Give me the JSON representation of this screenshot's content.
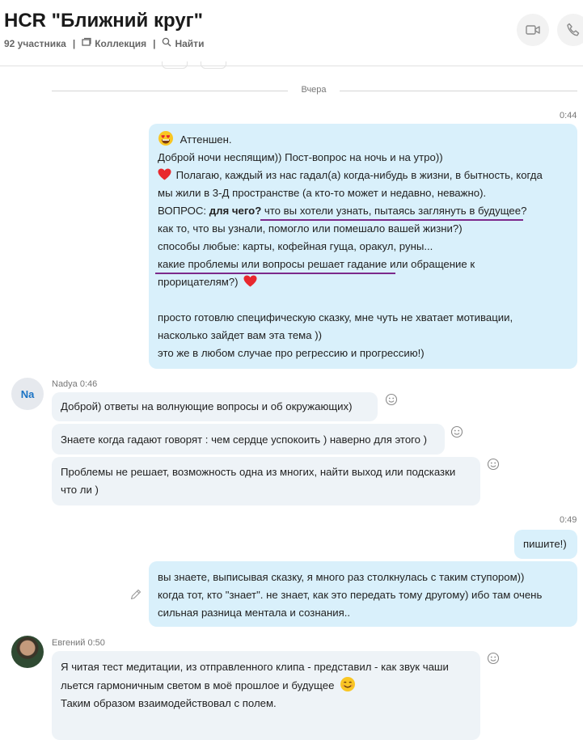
{
  "header": {
    "title": "HCR \"Ближний круг\"",
    "participants": "92 участника",
    "collection": "Коллекция",
    "find": "Найти"
  },
  "divider": {
    "label": "Вчера"
  },
  "messages": {
    "m1": {
      "time": "0:44",
      "l1": "Аттеншен.",
      "l2": "Доброй ночи неспящим)) Пост-вопрос на ночь и на утро))",
      "l3": "Полагаю, каждый из нас гадал(а) когда-нибудь в жизни, в бытность, когда",
      "l4": "мы жили в 3-Д пространстве (а кто-то может и недавно, неважно).",
      "l5a": "ВОПРОС: ",
      "l5b": "для чего?",
      "l5c": " что вы хотели узнать, пытаясь заглянуть в будущее?",
      "l6": "как то, что вы узнали, помогло или помешало вашей жизни?)",
      "l7": "способы любые: карты, кофейная гуща, оракул, руны...",
      "l8": "какие проблемы или вопросы решает гадание или обращение к",
      "l9": "прорицателям?)",
      "l10": "просто готовлю специфическую сказку, мне чуть не хватает мотивации,",
      "l11": "насколько зайдет вам эта тема ))",
      "l12": "это же в любом случае про регрессию и прогрессию!)"
    },
    "nadya": {
      "avatar": "Na",
      "sender": "Nadya 0:46",
      "b1": "Доброй) ответы на волнующие вопросы и об окружающих)",
      "b2": "Знаете когда гадают говорят : чем сердце успокоить ) наверно для этого )",
      "b3l1": "Проблемы не решает, возможность одна из многих, найти выход или подсказки",
      "b3l2": "что ли )"
    },
    "m2": {
      "time": "0:49",
      "b1": "пишите!)",
      "b2l1": "вы знаете, выписывая сказку, я много раз столкнулась с таким ступором))",
      "b2l2": "когда тот, кто \"знает\". не знает, как это передать тому другому) ибо там очень",
      "b2l3": "сильная разница ментала и сознания.."
    },
    "evgeny": {
      "sender": "Евгений 0:50",
      "l1": "Я читая тест медитации, из отправленного клипа - представил - как звук чаши",
      "l2": "льется гармоничным светом в моё прошлое и будущее",
      "l3": "Таким образом взаимодействовал с полем."
    }
  },
  "colors": {
    "outgoing_bubble": "#d9f0fb",
    "incoming_bubble": "#eef3f7",
    "underline": "#7c2a8b",
    "avatar_text": "#1a73c4"
  },
  "icons": [
    "collection-icon",
    "search-icon",
    "video-call-icon",
    "phone-call-icon",
    "heart-eyes-emoji-icon",
    "heart-emoji-icon",
    "smile-emoji-icon",
    "add-reaction-icon",
    "edit-pencil-icon"
  ]
}
